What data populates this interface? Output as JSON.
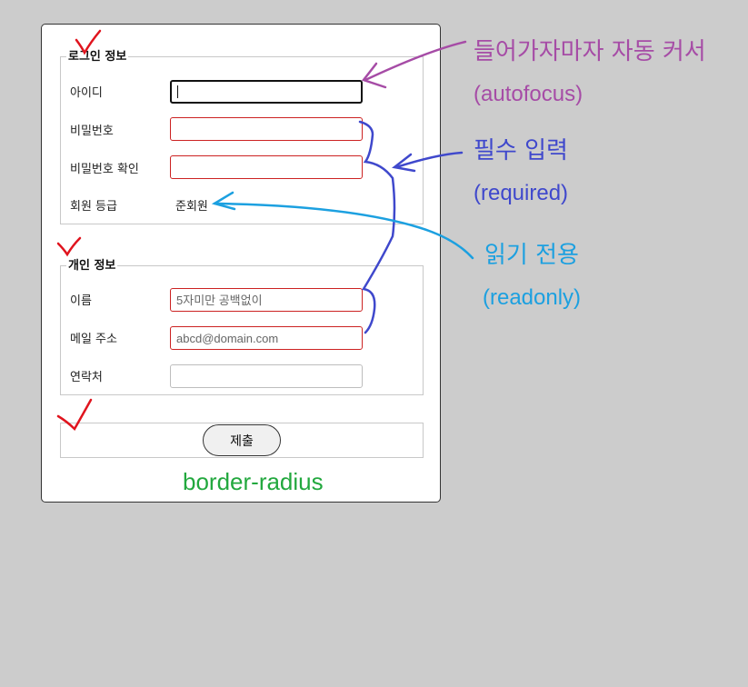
{
  "login": {
    "legend": "로그인 정보",
    "id_label": "아이디",
    "id_value": "",
    "password_label": "비밀번호",
    "password_value": "",
    "password_confirm_label": "비밀번호 확인",
    "password_confirm_value": "",
    "grade_label": "회원 등급",
    "grade_value": "준회원"
  },
  "personal": {
    "legend": "개인 정보",
    "name_label": "이름",
    "name_placeholder": "5자미만 공백없이",
    "email_label": "메일 주소",
    "email_placeholder": "abcd@domain.com",
    "phone_label": "연락처",
    "phone_value": ""
  },
  "submit": {
    "label": "제출"
  },
  "annotations": {
    "autofocus_title": "들어가자마자 자동 커서",
    "autofocus_sub": "(autofocus)",
    "required_title": "필수 입력",
    "required_sub": "(required)",
    "readonly_title": "읽기 전용",
    "readonly_sub": "(readonly)",
    "border_radius": "border-radius"
  },
  "colors": {
    "autofocus": "#a64ca6",
    "required": "#3f48cc",
    "readonly": "#1ca0e0",
    "border_radius": "#22a83e",
    "checkmark": "#e0141e",
    "required_border": "#cc2222",
    "background": "#cccccc"
  }
}
